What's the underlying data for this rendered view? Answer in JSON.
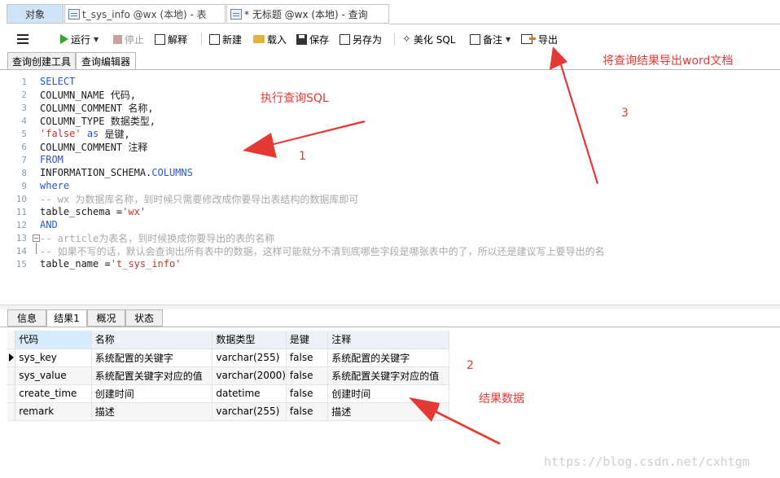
{
  "tabs": [
    {
      "label": "对象"
    },
    {
      "label": "t_sys_info @wx (本地) - 表"
    },
    {
      "label": "* 无标题 @wx (本地) - 查询"
    }
  ],
  "toolbar": {
    "run": "运行",
    "stop": "停止",
    "explain": "解释",
    "new": "新建",
    "load": "载入",
    "save": "保存",
    "save_as": "另存为",
    "beautify": "美化 SQL",
    "note": "备注",
    "export": "导出"
  },
  "subtabs": [
    "查询创建工具",
    "查询编辑器"
  ],
  "editor": {
    "lines": [
      {
        "n": "1",
        "text": "SELECT"
      },
      {
        "n": "2",
        "text": "COLUMN_NAME 代码,"
      },
      {
        "n": "3",
        "text": "COLUMN_COMMENT 名称,"
      },
      {
        "n": "4",
        "text": "COLUMN_TYPE 数据类型,"
      },
      {
        "n": "5",
        "str": "'false'",
        "kw": "as",
        "text": "是键,"
      },
      {
        "n": "6",
        "text": "COLUMN_COMMENT 注释"
      },
      {
        "n": "7",
        "text": "FROM"
      },
      {
        "n": "8",
        "text": "INFORMATION_SCHEMA.",
        "kw": "COLUMNS"
      },
      {
        "n": "9",
        "text": "where"
      },
      {
        "n": "10",
        "text": "-- wx 为数据库名称，到时候只需要修改成你要导出表结构的数据库即可"
      },
      {
        "n": "11",
        "text": "table_schema =",
        "str": "'wx'"
      },
      {
        "n": "12",
        "text": "AND"
      },
      {
        "n": "13",
        "text": "-- article为表名，到时候换成你要导出的表的名称"
      },
      {
        "n": "14",
        "text": "-- 如果不写的话，默认会查询出所有表中的数据，这样可能就分不清到底哪些字段是哪张表中的了，所以还是建议写上要导出的名"
      },
      {
        "n": "15",
        "text": "table_name = ",
        "str": "'t_sys_info'"
      }
    ]
  },
  "result_tabs": [
    "信息",
    "结果1",
    "概况",
    "状态"
  ],
  "grid": {
    "headers": [
      "代码",
      "名称",
      "数据类型",
      "是键",
      "注释"
    ],
    "rows": [
      [
        "sys_key",
        "系统配置的关键字",
        "varchar(255)",
        "false",
        "系统配置的关键字"
      ],
      [
        "sys_value",
        "系统配置关键字对应的值",
        "varchar(2000)",
        "false",
        "系统配置关键字对应的值"
      ],
      [
        "create_time",
        "创建时间",
        "datetime",
        "false",
        "创建时间"
      ],
      [
        "remark",
        "描述",
        "varchar(255)",
        "false",
        "描述"
      ]
    ]
  },
  "annotations": {
    "export_note": "将查询结果导出word文档",
    "exec_note": "执行查询SQL",
    "result_note": "结果数据",
    "n1": "1",
    "n2": "2",
    "n3": "3"
  },
  "watermark": "https://blog.csdn.net/cxhtgm",
  "colors": {
    "annotation": "#e53935",
    "keyword": "#2858d0",
    "string": "#c0392b",
    "comment": "#a8a8a8",
    "run": "#2fa52f"
  }
}
